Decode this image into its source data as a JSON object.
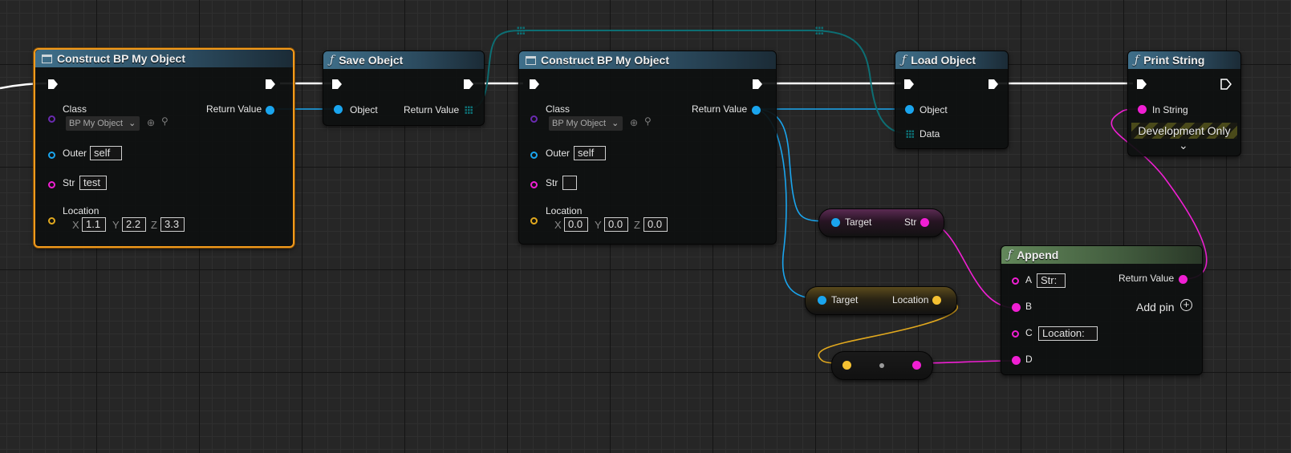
{
  "nodes": {
    "construct1": {
      "title": "Construct BP My Object",
      "class_label": "Class",
      "class_value": "BP My Object",
      "return_label": "Return Value",
      "outer_label": "Outer",
      "outer_value": "self",
      "str_label": "Str",
      "str_value": "test",
      "location_label": "Location",
      "x_label": "X",
      "x_value": "1.1",
      "y_label": "Y",
      "y_value": "2.2",
      "z_label": "Z",
      "z_value": "3.3"
    },
    "save": {
      "title": "Save Obejct",
      "object_label": "Object",
      "return_label": "Return Value"
    },
    "construct2": {
      "title": "Construct BP My Object",
      "class_label": "Class",
      "class_value": "BP My Object",
      "return_label": "Return Value",
      "outer_label": "Outer",
      "outer_value": "self",
      "str_label": "Str",
      "str_value": "",
      "location_label": "Location",
      "x_label": "X",
      "x_value": "0.0",
      "y_label": "Y",
      "y_value": "0.0",
      "z_label": "Z",
      "z_value": "0.0"
    },
    "load": {
      "title": "Load Object",
      "object_label": "Object",
      "data_label": "Data"
    },
    "print": {
      "title": "Print String",
      "in_string_label": "In String",
      "dev_only": "Development Only"
    },
    "get_str": {
      "target_label": "Target",
      "str_label": "Str"
    },
    "get_location": {
      "target_label": "Target",
      "location_label": "Location"
    },
    "append": {
      "title": "Append",
      "a_label": "A",
      "a_value": "Str:",
      "b_label": "B",
      "c_label": "C",
      "c_value": "Location:",
      "d_label": "D",
      "return_label": "Return Value",
      "add_pin_label": "Add pin"
    }
  },
  "colors": {
    "exec": "#ffffff",
    "object": "#1aa5ee",
    "class": "#6a2bb0",
    "string": "#f01fd3",
    "vector": "#f5c132",
    "struct": "#0d6e73",
    "selected": "#f29a1c"
  },
  "icons": [
    "class-icon",
    "function-icon",
    "browse-icon",
    "search-icon",
    "chevron-down-icon",
    "add-pin-icon",
    "exec-pin-icon"
  ]
}
